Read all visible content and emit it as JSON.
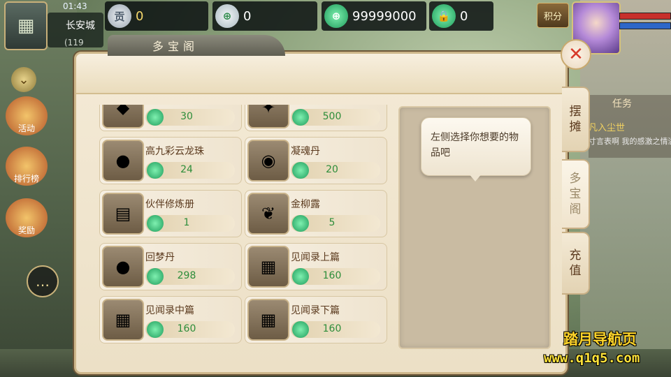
{
  "status": {
    "time": "01:43",
    "location": "长安城",
    "coords": "(119"
  },
  "currencies": {
    "contribution": {
      "icon_text": "贡",
      "value": "0"
    },
    "silver": {
      "icon_text": "⊕",
      "value": "0"
    },
    "jade": {
      "icon_text": "⊕",
      "value": "99999000"
    },
    "locked_jade": {
      "icon_text": "🔒",
      "value": "0"
    }
  },
  "points_button": "积分",
  "side_menu": {
    "activity": "活动",
    "ranking": "排行榜",
    "reward": "奖励"
  },
  "shop": {
    "title": "多宝阁",
    "close_symbol": "✕",
    "items": [
      {
        "name": "",
        "price": "30",
        "icon": "◆"
      },
      {
        "name": "",
        "price": "500",
        "icon": "✦"
      },
      {
        "name": "高九彩云龙珠",
        "price": "24",
        "icon": "●"
      },
      {
        "name": "凝魂丹",
        "price": "20",
        "icon": "◉"
      },
      {
        "name": "伙伴修炼册",
        "price": "1",
        "icon": "▤"
      },
      {
        "name": "金柳露",
        "price": "5",
        "icon": "❦"
      },
      {
        "name": "回梦丹",
        "price": "298",
        "icon": "●"
      },
      {
        "name": "见闻录上篇",
        "price": "160",
        "icon": "▦"
      },
      {
        "name": "见闻录中篇",
        "price": "160",
        "icon": "▦"
      },
      {
        "name": "见闻录下篇",
        "price": "160",
        "icon": "▦"
      }
    ],
    "hint": "左侧选择你想要的物品吧"
  },
  "tabs": {
    "stall": [
      "摆",
      "摊"
    ],
    "shop": [
      "多",
      "宝",
      "阁"
    ],
    "recharge": [
      "充",
      "值"
    ]
  },
  "task": {
    "title": "任务",
    "line1": "凡入尘世",
    "line2": "寸言表啊 我的感激之情溢"
  },
  "watermark": {
    "name": "踏月导航页",
    "url": "www.q1q5.com"
  },
  "colors": {
    "panel_bg": "#f4ead6",
    "price_green": "#2d8d3a",
    "item_name": "#5b3a1e",
    "close_red": "#d73a2a"
  }
}
